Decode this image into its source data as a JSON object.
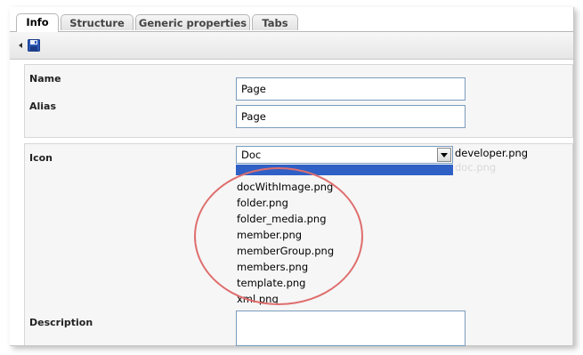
{
  "tabs": [
    {
      "label": "Info",
      "active": true
    },
    {
      "label": "Structure",
      "active": false
    },
    {
      "label": "Generic properties",
      "active": false
    },
    {
      "label": "Tabs",
      "active": false
    }
  ],
  "toolbar": {
    "save_icon": "floppy-disk-icon",
    "arrow_icon": "left-arrow-icon"
  },
  "form": {
    "name_label": "Name",
    "name_value": "Page",
    "alias_label": "Alias",
    "alias_value": "Page",
    "icon_label": "Icon",
    "icon_selected": "Doc",
    "icon_beside": "developer.png",
    "icon_beside_ghost": "doc.png",
    "description_label": "Description"
  },
  "dropdown_options": [
    "docWithImage.png",
    "folder.png",
    "folder_media.png",
    "member.png",
    "memberGroup.png",
    "members.png",
    "template.png",
    "xml.png"
  ],
  "colors": {
    "highlight": "#2f60c6",
    "annotation_circle": "#df6e6e"
  }
}
